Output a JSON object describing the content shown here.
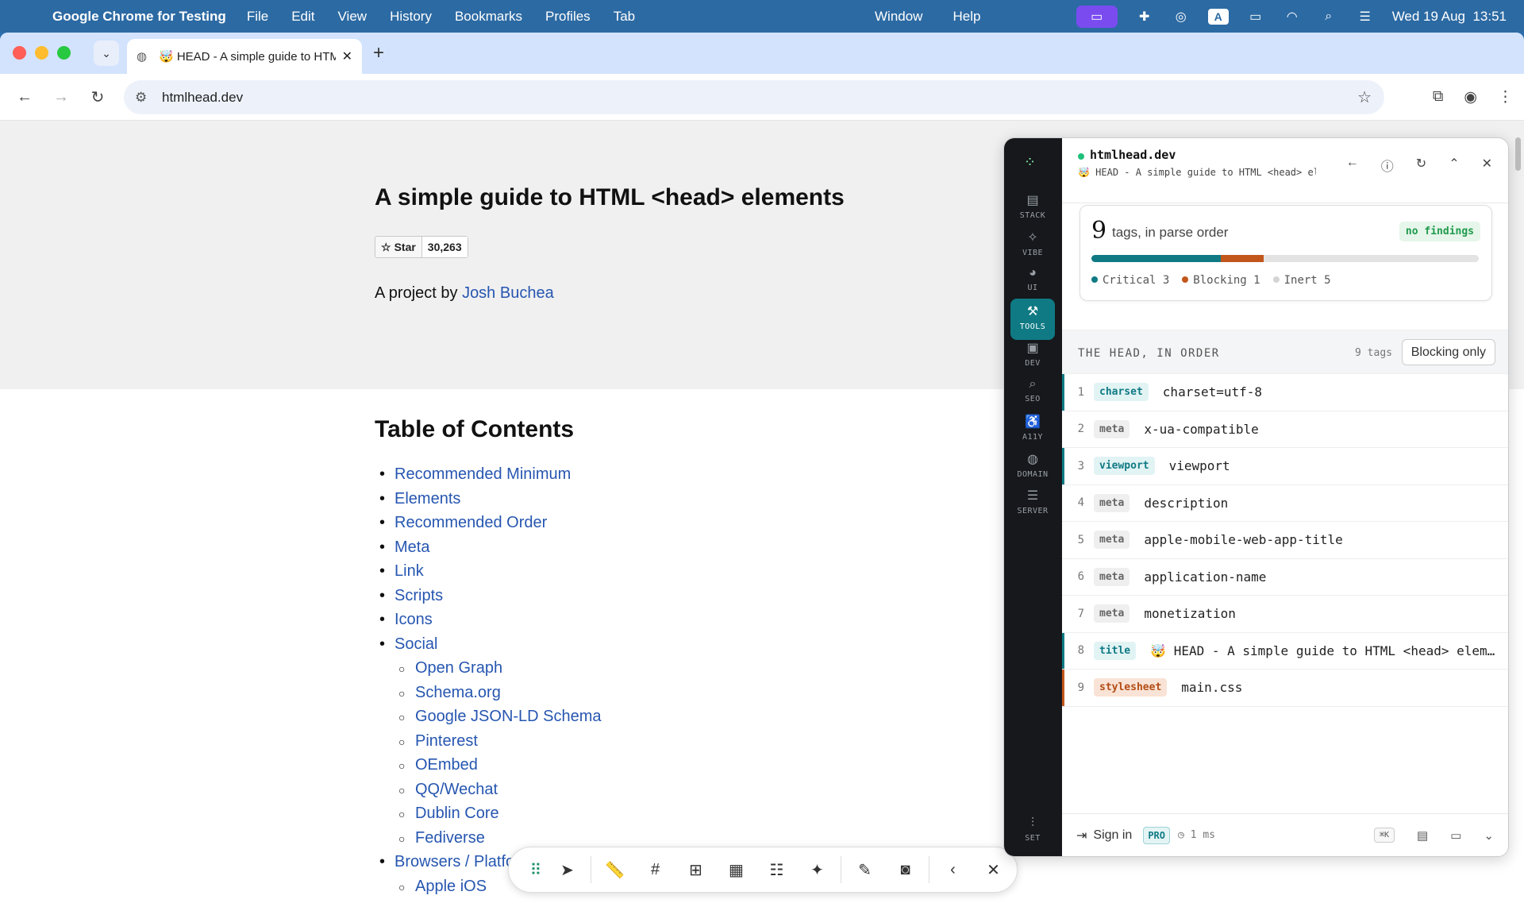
{
  "menubar": {
    "app": "Google Chrome for Testing",
    "items": [
      "File",
      "Edit",
      "View",
      "History",
      "Bookmarks",
      "Profiles",
      "Tab"
    ],
    "items_mid": [
      "Window",
      "Help"
    ],
    "status_a": "A",
    "clock": "Wed 19 Aug  13:51"
  },
  "browser": {
    "tab_title": "🤯 HEAD - A simple guide to HTML <head> elements",
    "url": "htmlhead.dev"
  },
  "page": {
    "title": "A simple guide to HTML <head> elements",
    "star_label": "Star",
    "star_count": "30,263",
    "byline_prefix": "A project by ",
    "author": "Josh Buchea",
    "toc_title": "Table of Contents",
    "toc": [
      {
        "label": "Recommended Minimum",
        "level": 1
      },
      {
        "label": "Elements",
        "level": 1
      },
      {
        "label": "Recommended Order",
        "level": 1
      },
      {
        "label": "Meta",
        "level": 1
      },
      {
        "label": "Link",
        "level": 1
      },
      {
        "label": "Scripts",
        "level": 1
      },
      {
        "label": "Icons",
        "level": 1
      },
      {
        "label": "Social",
        "level": 1
      },
      {
        "label": "Open Graph",
        "level": 2
      },
      {
        "label": "Schema.org",
        "level": 2
      },
      {
        "label": "Google JSON-LD Schema",
        "level": 2
      },
      {
        "label": "Pinterest",
        "level": 2
      },
      {
        "label": "OEmbed",
        "level": 2
      },
      {
        "label": "QQ/Wechat",
        "level": 2
      },
      {
        "label": "Dublin Core",
        "level": 2
      },
      {
        "label": "Fediverse",
        "level": 2
      },
      {
        "label": "Browsers / Platforms",
        "level": 1
      },
      {
        "label": "Apple iOS",
        "level": 2
      }
    ]
  },
  "panel": {
    "domain": "htmlhead.dev",
    "page_title": "🤯 HEAD - A simple guide to HTML <head> elements",
    "rail": [
      "STACK",
      "VIBE",
      "UI",
      "TOOLS",
      "DEV",
      "SEO",
      "A11Y",
      "DOMAIN",
      "SERVER"
    ],
    "rail_bottom": "SET",
    "active_rail": "TOOLS",
    "summary": {
      "count": "9",
      "label": "tags, in parse order",
      "badge": "no findings",
      "critical_label": "Critical 3",
      "blocking_label": "Blocking 1",
      "inert_label": "Inert 5",
      "critical": 3,
      "blocking": 1,
      "inert": 5
    },
    "section_title": "THE HEAD, IN ORDER",
    "section_count": "9 tags",
    "filter_button": "Blocking only",
    "rows": [
      {
        "n": "1",
        "tag": "charset",
        "value": "charset=utf-8",
        "kind": "critical"
      },
      {
        "n": "2",
        "tag": "meta",
        "value": "x-ua-compatible",
        "kind": "inert"
      },
      {
        "n": "3",
        "tag": "viewport",
        "value": "viewport",
        "kind": "critical"
      },
      {
        "n": "4",
        "tag": "meta",
        "value": "description",
        "kind": "inert"
      },
      {
        "n": "5",
        "tag": "meta",
        "value": "apple-mobile-web-app-title",
        "kind": "inert"
      },
      {
        "n": "6",
        "tag": "meta",
        "value": "application-name",
        "kind": "inert"
      },
      {
        "n": "7",
        "tag": "meta",
        "value": "monetization",
        "kind": "inert"
      },
      {
        "n": "8",
        "tag": "title",
        "value": "🤯 HEAD - A simple guide to HTML <head> elements",
        "kind": "critical"
      },
      {
        "n": "9",
        "tag": "stylesheet",
        "value": "main.css",
        "kind": "blocking"
      }
    ],
    "footer": {
      "signin": "Sign in",
      "pro": "PRO",
      "timing": "1 ms",
      "shortcut": "⌘K"
    },
    "colors": {
      "critical": "#0f7a84",
      "blocking": "#c2561b",
      "inert": "#d4d4d4"
    }
  }
}
